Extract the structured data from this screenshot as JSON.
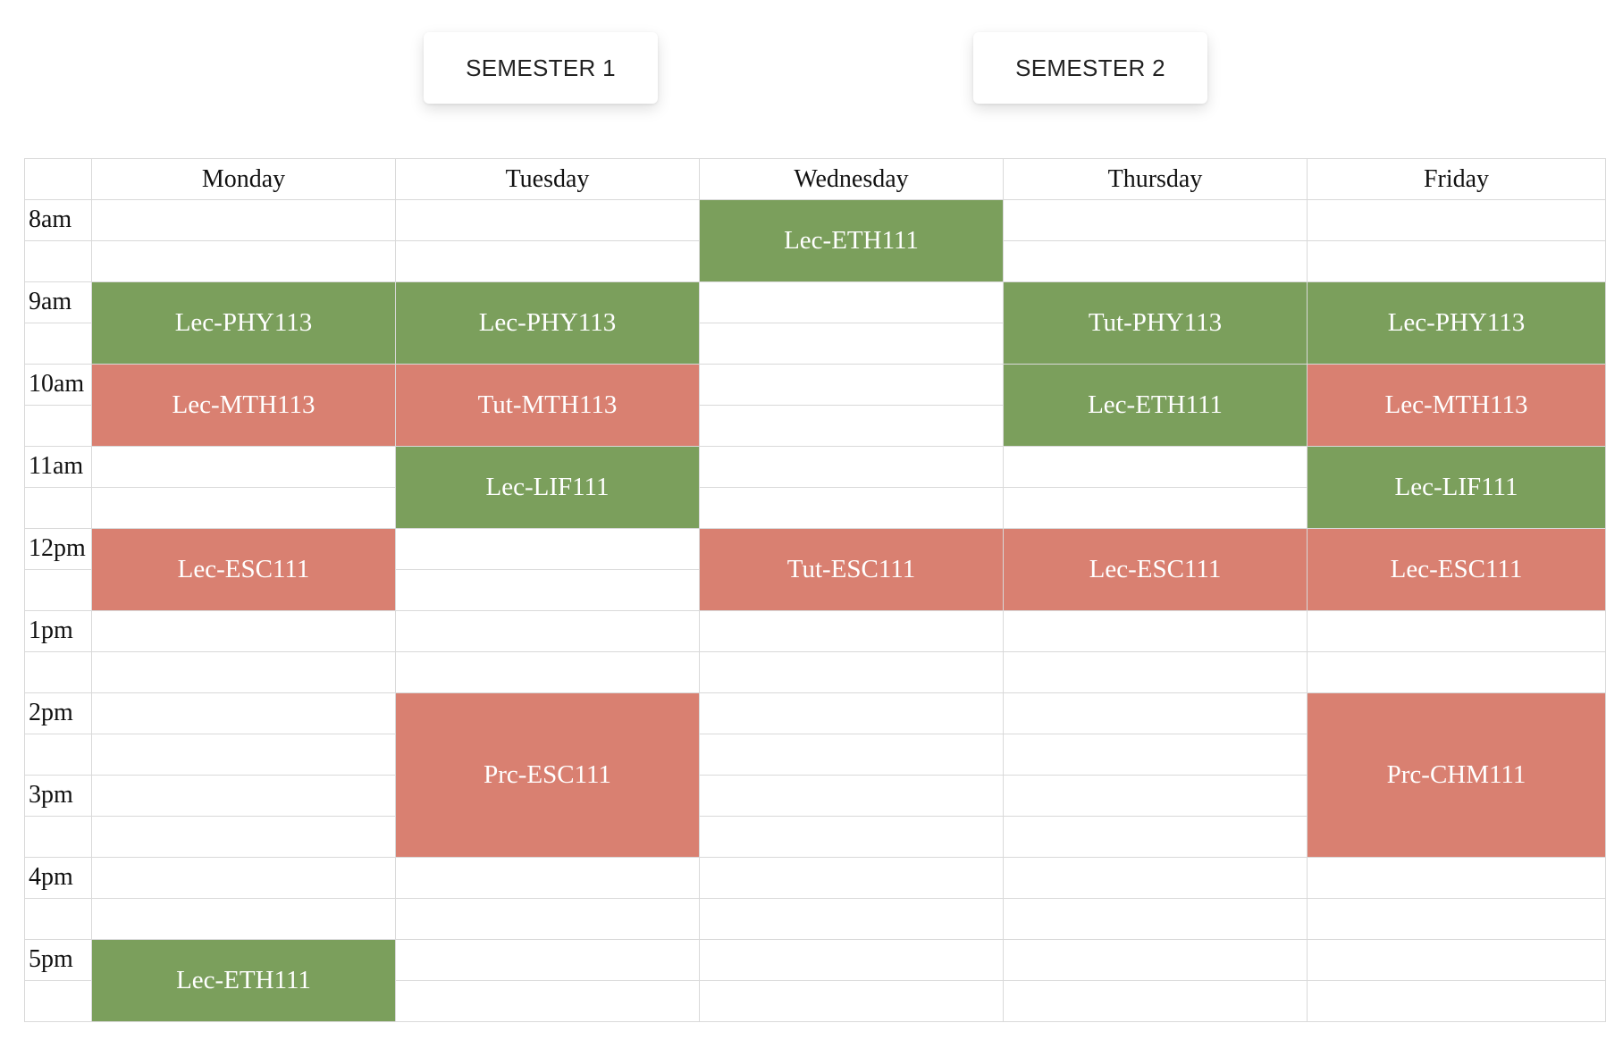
{
  "semesters": {
    "sem1": "SEMESTER 1",
    "sem2": "SEMESTER 2"
  },
  "days": [
    "Monday",
    "Tuesday",
    "Wednesday",
    "Thursday",
    "Friday"
  ],
  "times": [
    "8am",
    "9am",
    "10am",
    "11am",
    "12pm",
    "1pm",
    "2pm",
    "3pm",
    "4pm",
    "5pm"
  ],
  "colors": {
    "green": "#7b9f5c",
    "red": "#d98071",
    "grid": "#d9d9d9"
  },
  "events": [
    {
      "day": "Wednesday",
      "start": "8am",
      "label": "Lec-ETH111",
      "color": "green"
    },
    {
      "day": "Monday",
      "start": "9am",
      "label": "Lec-PHY113",
      "color": "green"
    },
    {
      "day": "Tuesday",
      "start": "9am",
      "label": "Lec-PHY113",
      "color": "green"
    },
    {
      "day": "Thursday",
      "start": "9am",
      "label": "Tut-PHY113",
      "color": "green"
    },
    {
      "day": "Friday",
      "start": "9am",
      "label": "Lec-PHY113",
      "color": "green"
    },
    {
      "day": "Monday",
      "start": "10am",
      "label": "Lec-MTH113",
      "color": "red"
    },
    {
      "day": "Tuesday",
      "start": "10am",
      "label": "Tut-MTH113",
      "color": "red"
    },
    {
      "day": "Thursday",
      "start": "10am",
      "label": "Lec-ETH111",
      "color": "green"
    },
    {
      "day": "Friday",
      "start": "10am",
      "label": "Lec-MTH113",
      "color": "red"
    },
    {
      "day": "Tuesday",
      "start": "11am",
      "label": "Lec-LIF111",
      "color": "green"
    },
    {
      "day": "Friday",
      "start": "11am",
      "label": "Lec-LIF111",
      "color": "green"
    },
    {
      "day": "Monday",
      "start": "12pm",
      "label": "Lec-ESC111",
      "color": "red"
    },
    {
      "day": "Wednesday",
      "start": "12pm",
      "label": "Tut-ESC111",
      "color": "red"
    },
    {
      "day": "Thursday",
      "start": "12pm",
      "label": "Lec-ESC111",
      "color": "red"
    },
    {
      "day": "Friday",
      "start": "12pm",
      "label": "Lec-ESC111",
      "color": "red"
    },
    {
      "day": "Tuesday",
      "start": "2pm",
      "end": "4pm",
      "label": "Prc-ESC111",
      "color": "red"
    },
    {
      "day": "Friday",
      "start": "2pm",
      "end": "4pm",
      "label": "Prc-CHM111",
      "color": "red"
    },
    {
      "day": "Monday",
      "start": "5pm",
      "label": "Lec-ETH111",
      "color": "green"
    }
  ]
}
